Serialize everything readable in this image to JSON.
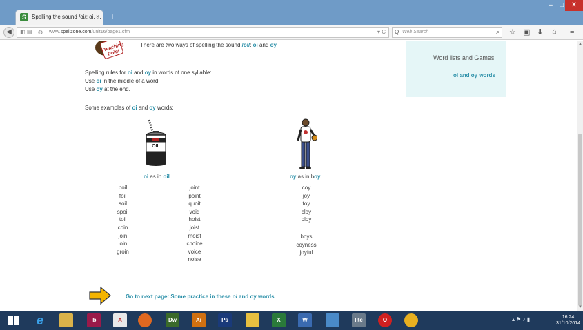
{
  "browser": {
    "tab_title": "Spelling the sound /oi/: oi, ...",
    "tab_favicon_letter": "S",
    "tab_close": "×",
    "new_tab": "+",
    "url_prefix": "www.",
    "url_domain": "spellzone.com",
    "url_path": "/unit16/page1.cfm",
    "search_placeholder": "Web Search",
    "win_min": "–",
    "win_max": "□",
    "win_close": "✕"
  },
  "content": {
    "intro_pre": "There are two ways of spelling the sound ",
    "intro_sound": "/oi/",
    "intro_colon": ":  ",
    "intro_oi": "oi",
    "intro_and": " and ",
    "intro_oy": "oy",
    "rules_pre": "Spelling rules for ",
    "rules_oi": "oi",
    "rules_and": " and ",
    "rules_oy": "oy",
    "rules_post": " in words of one syllable:",
    "rule1_use": "Use ",
    "rule1_oi": "oi",
    "rule1_post": " in the middle of a word",
    "rule2_use": "Use ",
    "rule2_oy": "oy",
    "rule2_post": " at the end.",
    "examples_pre": "Some examples of ",
    "examples_oi": "oi",
    "examples_and": " and ",
    "examples_oy": "oy",
    "examples_post": " words:",
    "oil_label": "OIL",
    "cap_oi": "oi",
    "cap_oi_as": " as in ",
    "cap_oi_word_pre": "",
    "cap_oi_word_hl": "oi",
    "cap_oi_word_post": "l",
    "cap_oy": "oy",
    "cap_oy_as": " as in ",
    "cap_oy_word_pre": "b",
    "cap_oy_word_hl": "oy",
    "col1": [
      "boil",
      "foil",
      "soil",
      "spoil",
      "toil",
      "coin",
      "join",
      "loin",
      "groin"
    ],
    "col2": [
      "joint",
      "point",
      "quoit",
      "void",
      "hoist",
      "joist",
      "moist",
      "choice",
      "voice",
      "noise"
    ],
    "col3a": [
      "coy",
      "joy",
      "toy",
      "cloy",
      "ploy"
    ],
    "col3b": [
      "boys",
      "coyness",
      "joyful"
    ],
    "next_pre": "Go to next page: Some practice in these ",
    "next_oi": "oi",
    "next_and": " and ",
    "next_oy": "oy",
    "next_post": " words"
  },
  "sidebar": {
    "title": "Word lists and Games",
    "link": "oi and oy words"
  },
  "taskbar": {
    "clock_time": "16:24",
    "clock_date": "31/10/2014",
    "apps": [
      "Ib",
      "Dw",
      "Ai",
      "Ps",
      "lite"
    ]
  },
  "colors": {
    "accent": "#2a8fa8",
    "sidebox_bg": "#e5f6f7",
    "titlebar": "#6f9bc7",
    "taskbar": "#1f3a5c"
  }
}
